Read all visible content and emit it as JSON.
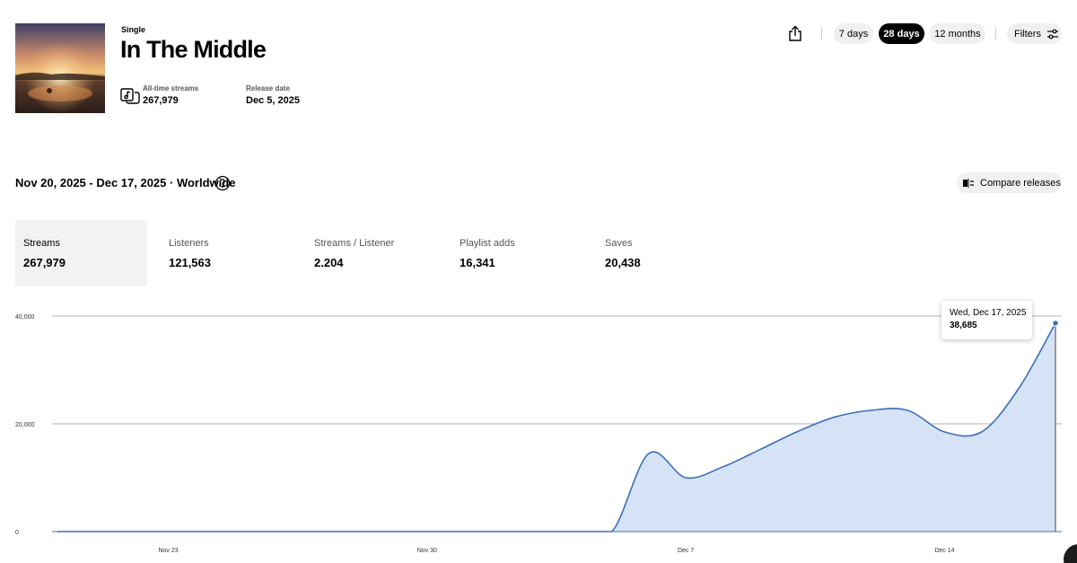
{
  "release": {
    "type_label": "Single",
    "title": "In The Middle",
    "cover_art": "sunset-lake-photo"
  },
  "stats": {
    "streams_label": "All-time streams",
    "streams_value": "267,979",
    "release_label": "Release date",
    "release_value": "Dec 5, 2025"
  },
  "toolbar": {
    "share_icon": "share-icon",
    "periods": [
      "7 days",
      "28 days",
      "12 months"
    ],
    "active_period": "28 days",
    "filters_label": "Filters"
  },
  "range_text": "Nov 20, 2025 - Dec 17, 2025 · Worldwide",
  "compare_label": "Compare releases",
  "metrics": [
    {
      "label": "Streams",
      "value": "267,979",
      "active": true
    },
    {
      "label": "Listeners",
      "value": "121,563"
    },
    {
      "label": "Streams / Listener",
      "value": "2.204"
    },
    {
      "label": "Playlist adds",
      "value": "16,341"
    },
    {
      "label": "Saves",
      "value": "20,438"
    }
  ],
  "tooltip": {
    "date": "Wed, Dec 17, 2025",
    "value": "38,685"
  },
  "colors": {
    "line": "#3b6fb6",
    "fill": "#d6e3f7",
    "grid": "#9a9a9a",
    "active_pill": "#000000"
  },
  "chart_data": {
    "type": "area",
    "x": [
      "2025-11-20",
      "2025-11-21",
      "2025-11-22",
      "2025-11-23",
      "2025-11-24",
      "2025-11-25",
      "2025-11-26",
      "2025-11-27",
      "2025-11-28",
      "2025-11-29",
      "2025-11-30",
      "2025-12-01",
      "2025-12-02",
      "2025-12-03",
      "2025-12-04",
      "2025-12-05",
      "2025-12-06",
      "2025-12-07",
      "2025-12-08",
      "2025-12-09",
      "2025-12-10",
      "2025-12-11",
      "2025-12-12",
      "2025-12-13",
      "2025-12-14",
      "2025-12-15",
      "2025-12-16",
      "2025-12-17"
    ],
    "values": [
      0,
      0,
      0,
      0,
      0,
      0,
      0,
      0,
      0,
      0,
      0,
      0,
      0,
      0,
      0,
      0,
      14500,
      10000,
      12000,
      15200,
      18500,
      21200,
      22500,
      22500,
      18500,
      18500,
      26500,
      38685
    ],
    "x_tick_labels": [
      "Nov 23",
      "Nov 30",
      "Dec 7",
      "Dec 14"
    ],
    "x_tick_index": [
      3,
      10,
      17,
      24
    ],
    "y_ticks": [
      0,
      20000,
      40000
    ],
    "y_tick_labels": [
      "0",
      "20,000",
      "40,000"
    ],
    "ylim": [
      0,
      40000
    ],
    "grid": true,
    "xlabel": "",
    "ylabel": ""
  }
}
